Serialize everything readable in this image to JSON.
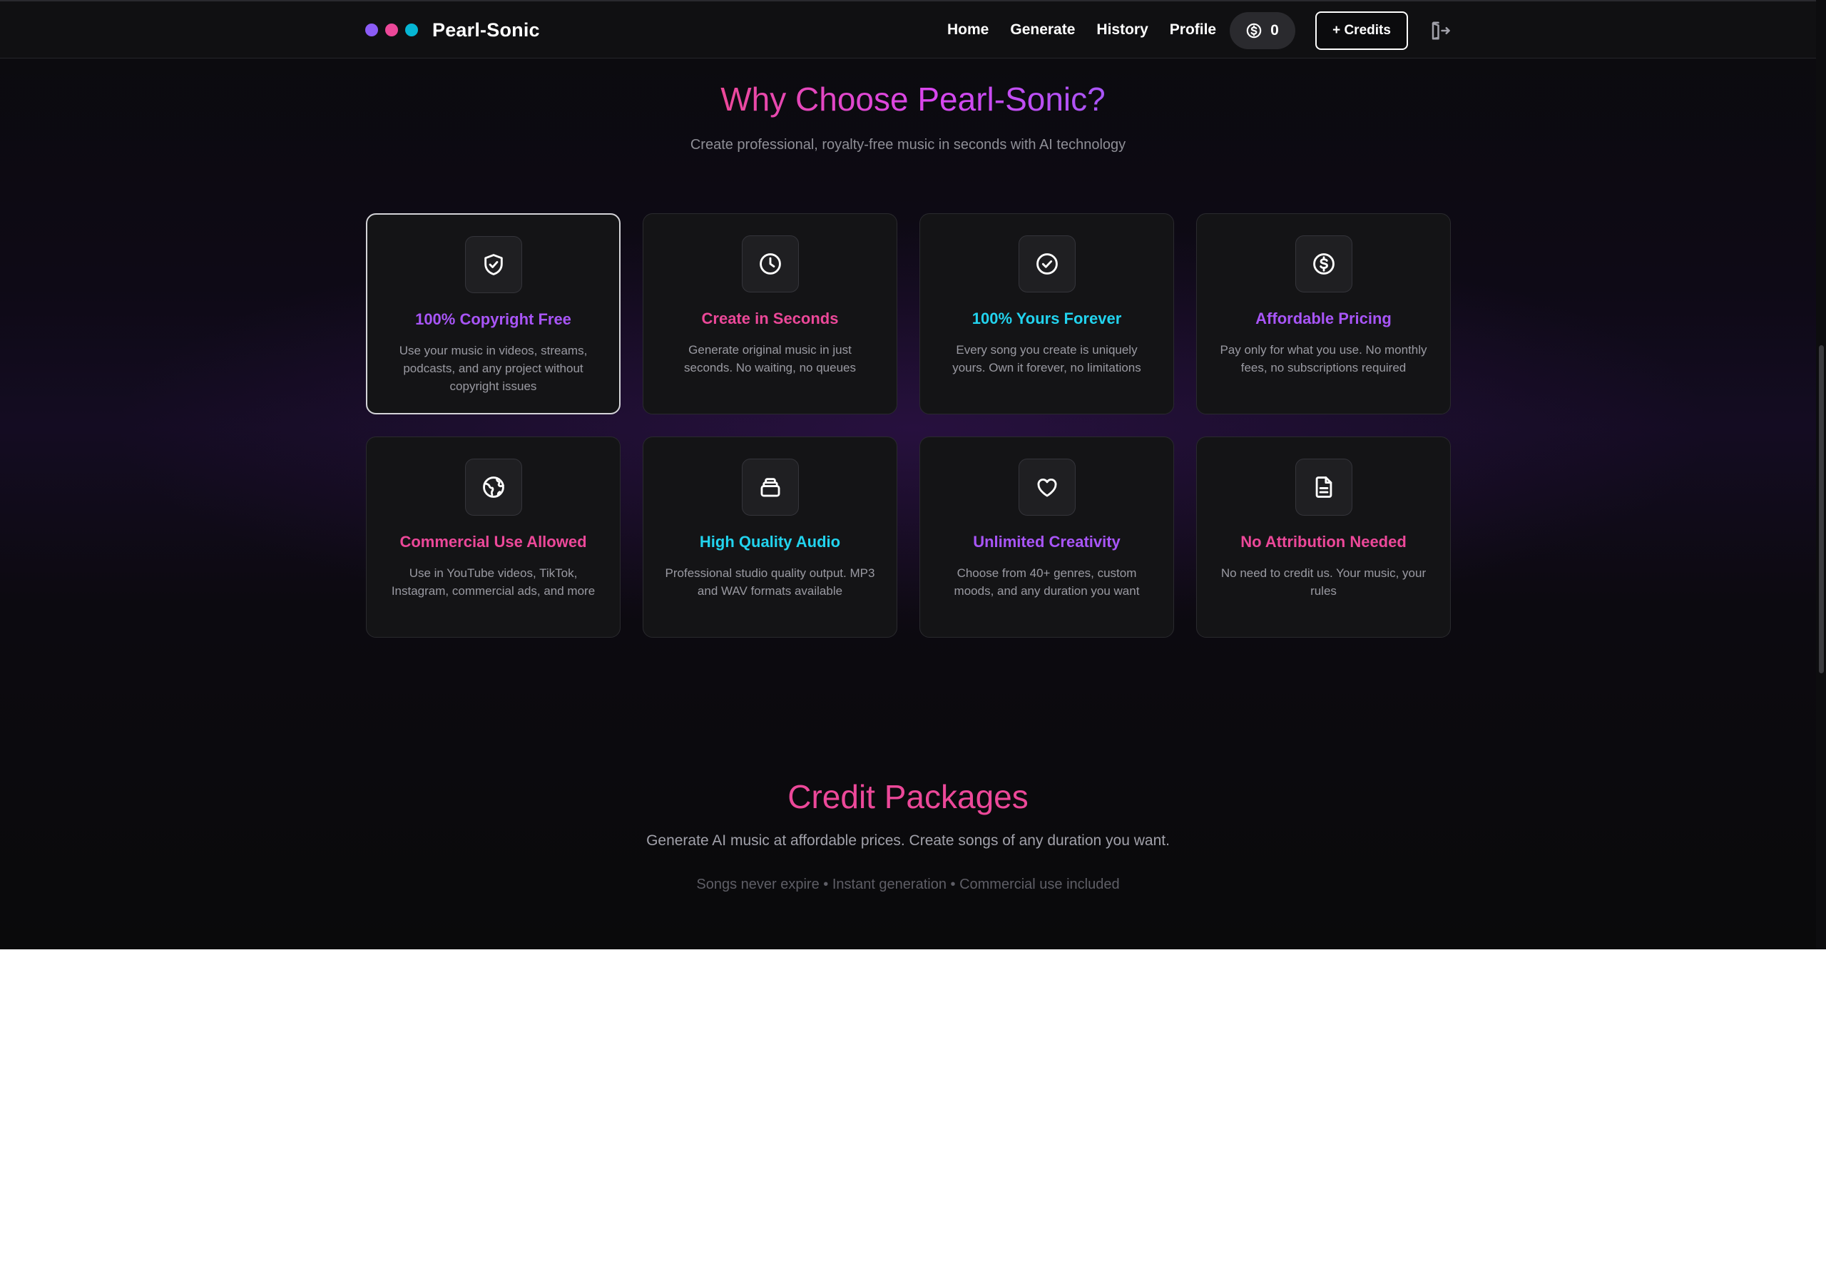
{
  "brand": {
    "name": "Pearl-Sonic",
    "dot_colors": [
      "#8b5cf6",
      "#ec4899",
      "#06b6d4"
    ]
  },
  "nav": {
    "links": [
      "Home",
      "Generate",
      "History",
      "Profile"
    ],
    "credit_balance": "0",
    "add_credits_label": "+ Credits"
  },
  "why": {
    "title": "Why Choose Pearl-Sonic?",
    "subtitle": "Create professional, royalty-free music in seconds with AI technology",
    "features": [
      {
        "title": "100% Copyright Free",
        "desc": "Use your music in videos, streams, podcasts, and any project without copyright issues",
        "color": "#a855f7",
        "icon": "shield-check-icon"
      },
      {
        "title": "Create in Seconds",
        "desc": "Generate original music in just seconds. No waiting, no queues",
        "color": "#ec4899",
        "icon": "clock-icon"
      },
      {
        "title": "100% Yours Forever",
        "desc": "Every song you create is uniquely yours. Own it forever, no limitations",
        "color": "#22d3ee",
        "icon": "check-circle-icon"
      },
      {
        "title": "Affordable Pricing",
        "desc": "Pay only for what you use. No monthly fees, no subscriptions required",
        "color": "#a855f7",
        "icon": "dollar-circle-icon"
      },
      {
        "title": "Commercial Use Allowed",
        "desc": "Use in YouTube videos, TikTok, Instagram, commercial ads, and more",
        "color": "#ec4899",
        "icon": "globe-icon"
      },
      {
        "title": "High Quality Audio",
        "desc": "Professional studio quality output. MP3 and WAV formats available",
        "color": "#22d3ee",
        "icon": "layers-icon"
      },
      {
        "title": "Unlimited Creativity",
        "desc": "Choose from 40+ genres, custom moods, and any duration you want",
        "color": "#a855f7",
        "icon": "heart-icon"
      },
      {
        "title": "No Attribution Needed",
        "desc": "No need to credit us. Your music, your rules",
        "color": "#ec4899",
        "icon": "file-text-icon"
      }
    ]
  },
  "credits": {
    "title": "Credit Packages",
    "subtitle": "Generate AI music at affordable prices. Create songs of any duration you want.",
    "features_line": "Songs never expire • Instant generation • Commercial use included"
  }
}
